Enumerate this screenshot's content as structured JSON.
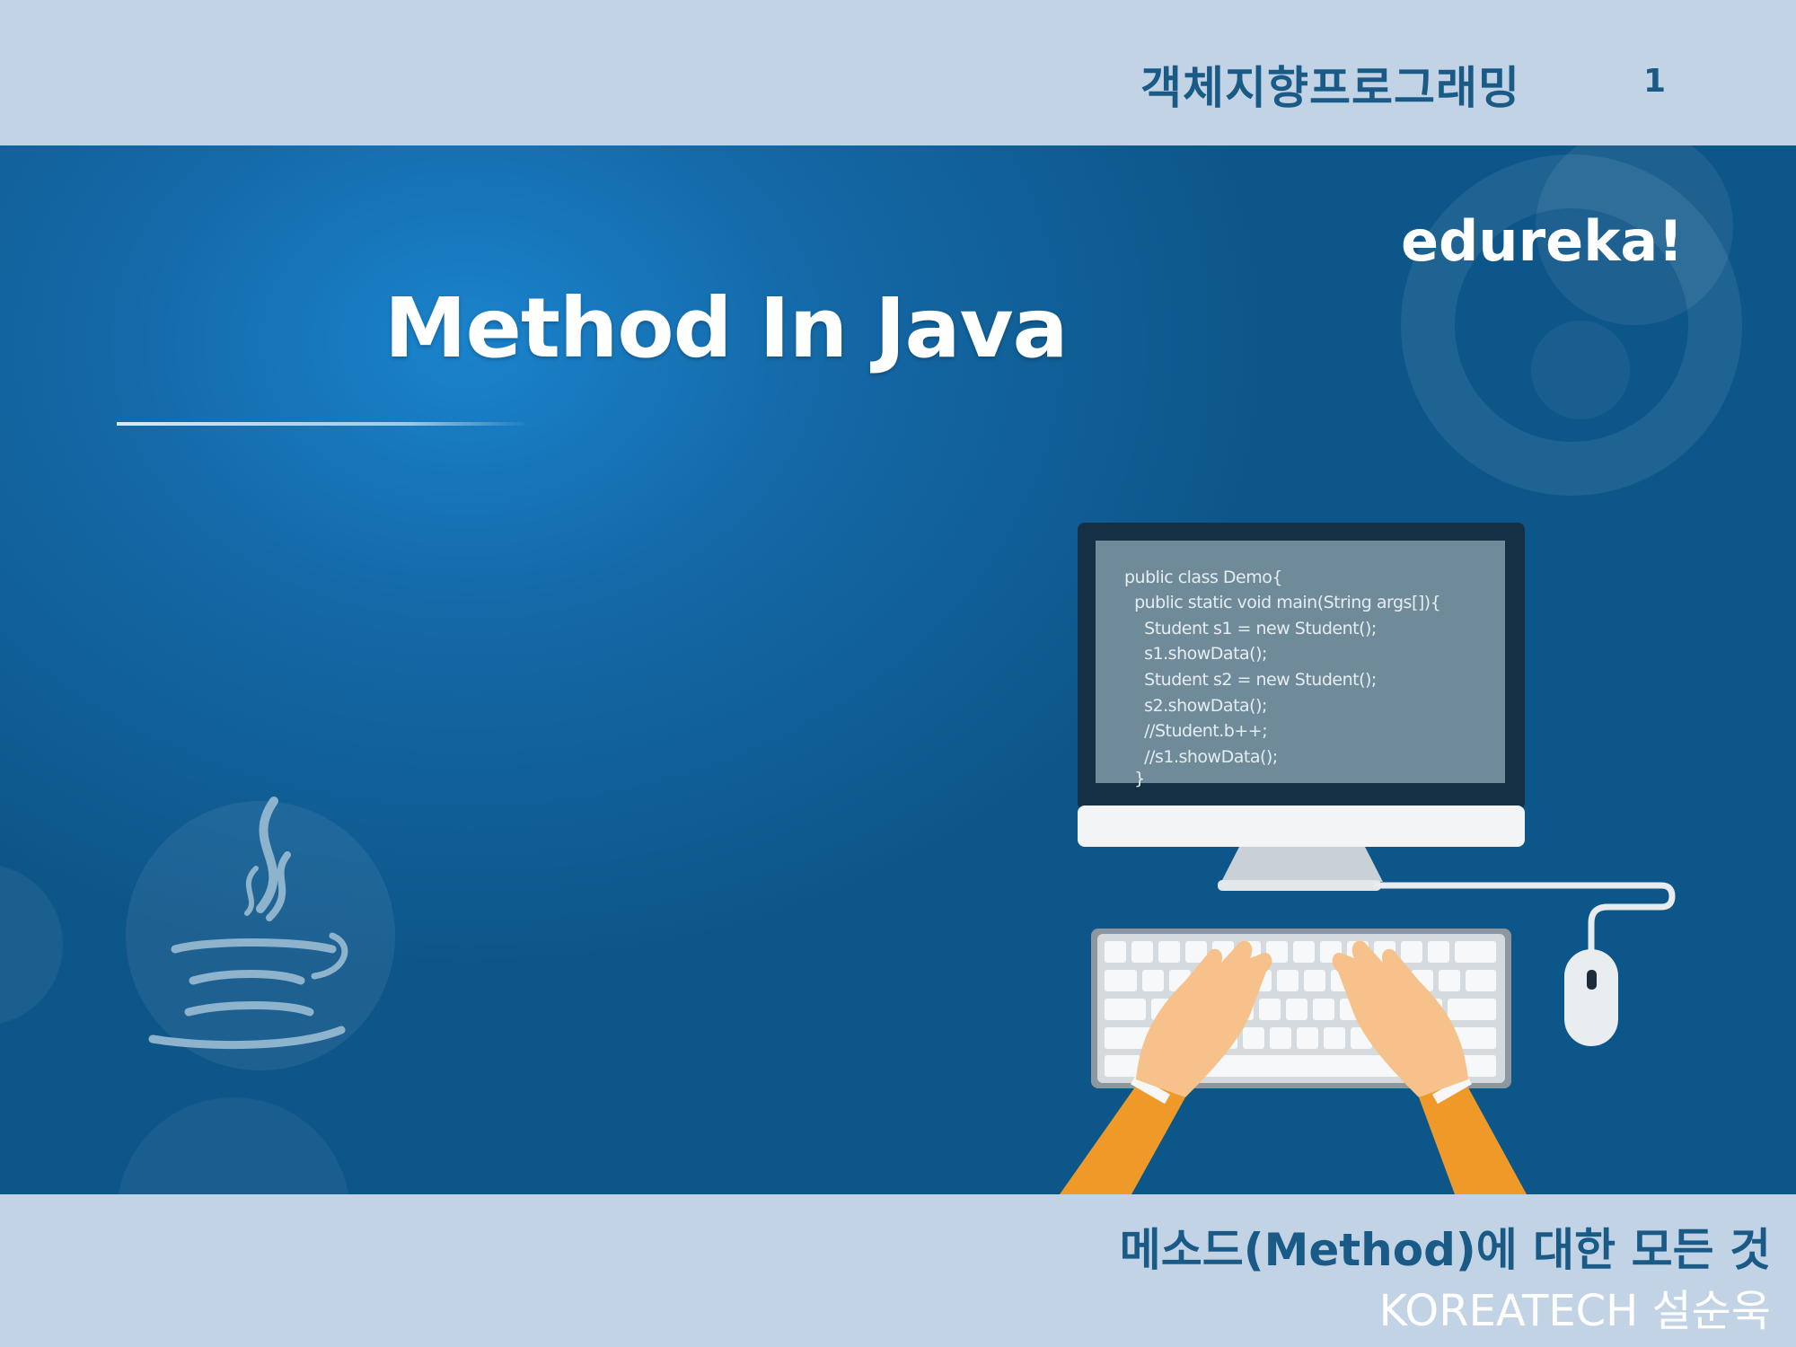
{
  "header": {
    "course_title": "객체지향프로그래밍",
    "page_number": "1"
  },
  "banner": {
    "title": "Method In Java",
    "brand": "edureka!",
    "code_lines": [
      "public class Demo{",
      "  public static void main(String args[]){",
      "    Student s1 = new Student();",
      "    s1.showData();",
      "    Student s2 = new Student();",
      "    s2.showData();",
      "    //Student.b++;",
      "    //s1.showData();",
      "  }"
    ]
  },
  "footer": {
    "subtitle": "메소드(Method)에 대한 모든 것",
    "author": "KOREATECH 설순욱"
  },
  "colors": {
    "band_background": "#c2d3e5",
    "title_blue": "#1a5a86",
    "banner_blue": "#1468a6"
  },
  "icons": [
    "java-logo-icon",
    "computer-monitor-icon",
    "keyboard-icon",
    "mouse-icon",
    "typing-hands-icon"
  ]
}
